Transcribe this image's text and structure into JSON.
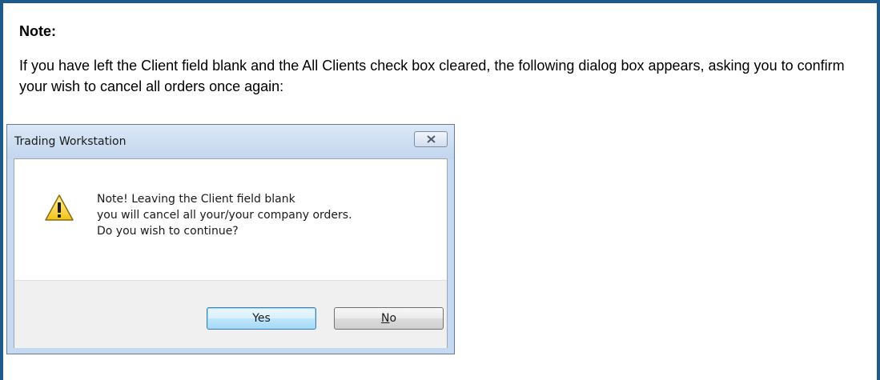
{
  "note": {
    "title": "Note:",
    "body": "If you have left the Client field blank and the All Clients check box cleared, the following dialog box appears, asking you to confirm your wish to cancel all orders once again:"
  },
  "dialog": {
    "title": "Trading Workstation",
    "message_lines": [
      "Note! Leaving the Client field blank",
      "you will cancel all your/your company orders.",
      "Do you wish to continue?"
    ],
    "icon": "warning-icon",
    "close_icon": "close-icon",
    "buttons": {
      "yes": "Yes",
      "no_mnemonic": "N",
      "no_rest": "o"
    }
  },
  "colors": {
    "border": "#1f5a8c",
    "dialog_frame": "#c5d9f0",
    "default_button": "#bee6fd"
  }
}
